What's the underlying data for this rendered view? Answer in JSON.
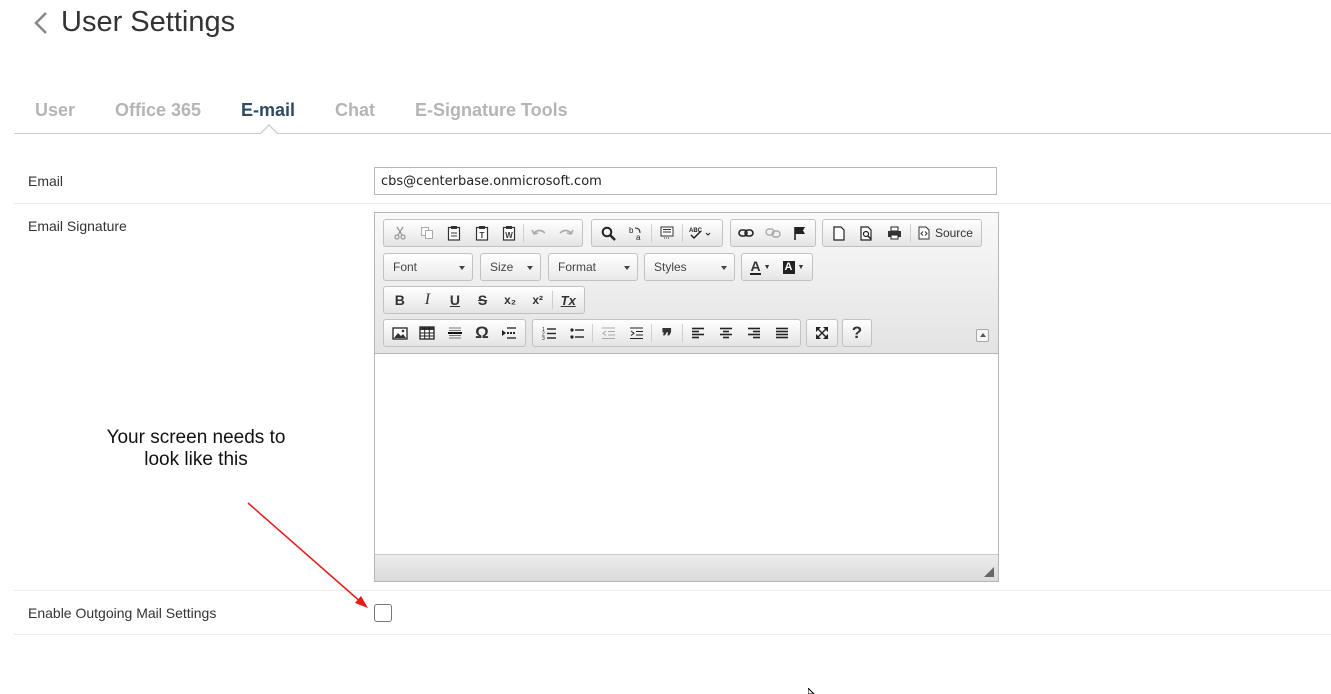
{
  "header": {
    "title": "User Settings",
    "back_icon": "chevron-left-icon"
  },
  "tabs": [
    {
      "label": "User",
      "active": false
    },
    {
      "label": "Office 365",
      "active": false
    },
    {
      "label": "E-mail",
      "active": true
    },
    {
      "label": "Chat",
      "active": false
    },
    {
      "label": "E-Signature Tools",
      "active": false
    }
  ],
  "form": {
    "email_label": "Email",
    "email_value": "cbs@centerbase.onmicrosoft.com",
    "signature_label": "Email Signature",
    "outgoing_label": "Enable Outgoing Mail Settings",
    "outgoing_checked": false
  },
  "editor": {
    "source_label": "Source",
    "font_label": "Font",
    "size_label": "Size",
    "format_label": "Format",
    "styles_label": "Styles",
    "help_label": "?",
    "omega_label": "Ω",
    "text_color_label": "A",
    "bg_color_label": "A",
    "bold_label": "B",
    "italic_label": "I",
    "underline_label": "U",
    "strike_label": "S",
    "subscript_label": "x₂",
    "superscript_label": "x²",
    "remove_format_label": "Tx",
    "quote_label": "❞"
  },
  "annotation": {
    "text_line1": "Your screen needs to",
    "text_line2": "look like this",
    "arrow_color": "#e31b1b"
  },
  "colors": {
    "active_tab": "#2d4b63",
    "inactive_tab": "#b5b5b5"
  }
}
